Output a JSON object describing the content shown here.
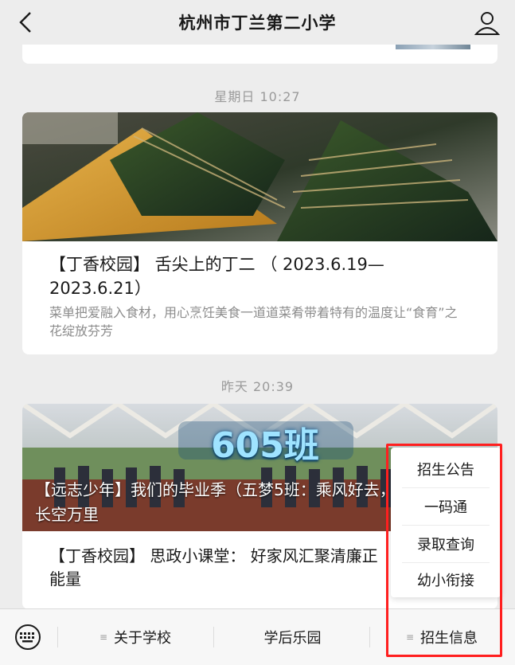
{
  "header": {
    "title": "杭州市丁兰第二小学",
    "back_icon": "chevron-left-icon",
    "profile_icon": "user-icon"
  },
  "feed": [
    {
      "time": "星期日 10:27",
      "title": "【丁香校园】 舌尖上的丁二 （ 2023.6.19—2023.6.21）",
      "summary": "菜单把爱融入食材，用心烹饪美食一道道菜肴带着特有的温度让“食育”之花绽放芬芳"
    },
    {
      "time": "昨天 20:39",
      "banner_text": "605班",
      "title": "【远志少年】我们的毕业季（五梦5班：乘风好去， 长空万里",
      "sub_title": "【丁香校园】 思政小课堂： 好家风汇聚清廉正能量"
    }
  ],
  "tabbar": {
    "keyboard_icon": "keyboard-icon",
    "tabs": [
      "关于学校",
      "学后乐园",
      "招生信息"
    ],
    "menu_marker": "≡"
  },
  "popup_menu": {
    "items": [
      "招生公告",
      "一码通",
      "录取查询",
      "幼小衔接"
    ]
  },
  "colors": {
    "highlight": "#ff1f1f",
    "background": "#ededed"
  }
}
